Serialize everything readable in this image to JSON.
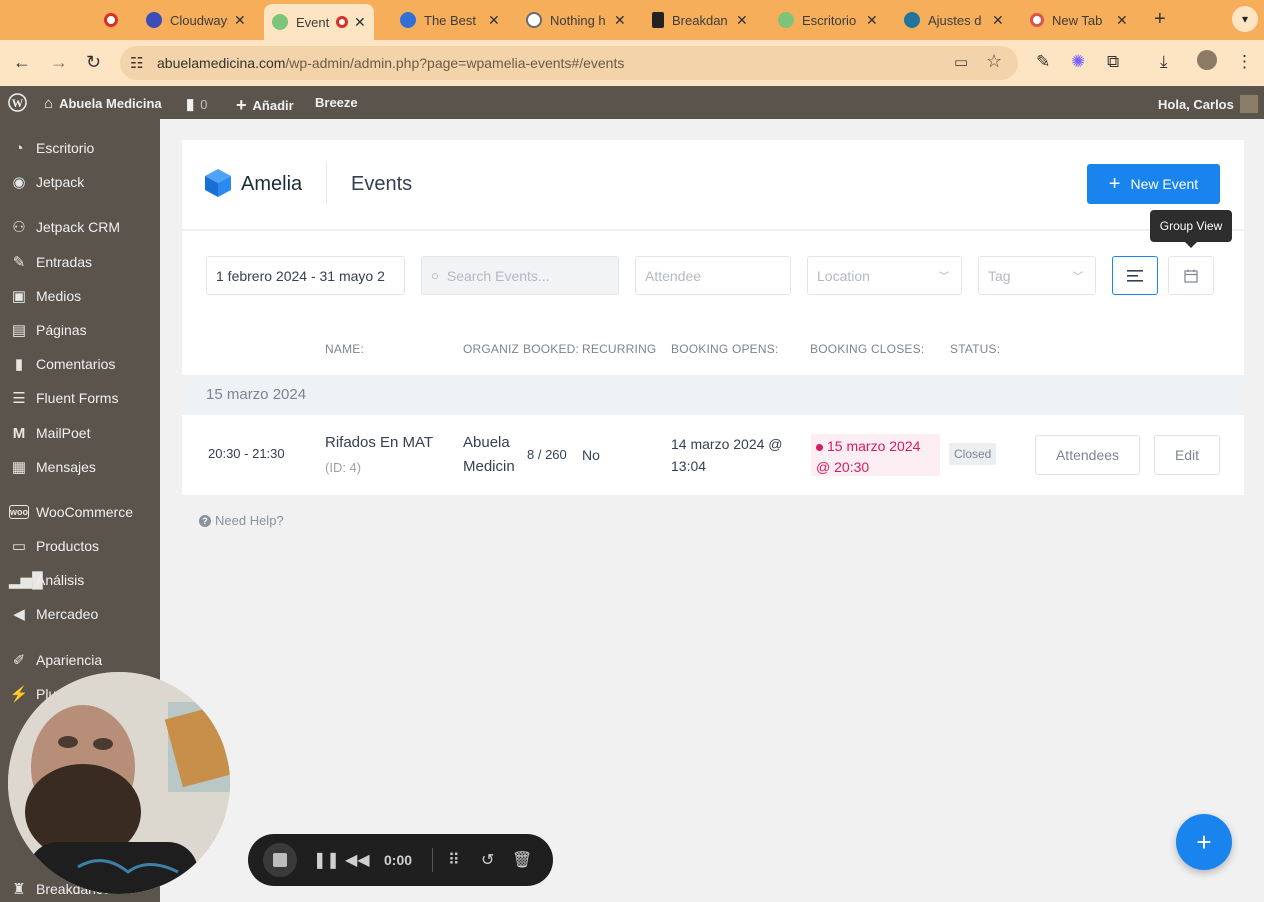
{
  "browser": {
    "tabs": [
      {
        "label": "",
        "favicon_color": "#d93025"
      },
      {
        "label": "Cloudways",
        "favicon_color": "#3b4db8"
      },
      {
        "label": "Events",
        "favicon_color": "#7cc47a",
        "active": true
      },
      {
        "label": "The Best",
        "favicon_color": "#2f6fd6"
      },
      {
        "label": "Nothing h",
        "favicon_color": "#6b6b6b"
      },
      {
        "label": "Breakdan",
        "favicon_color": "#222222"
      },
      {
        "label": "Escritorio",
        "favicon_color": "#7cc47a"
      },
      {
        "label": "Ajustes d",
        "favicon_color": "#21759b"
      },
      {
        "label": "New Tab",
        "favicon_color": "#d9534f"
      }
    ],
    "url_host": "abuelamedicina.com",
    "url_path": "/wp-admin/admin.php?page=wpamelia-events#/events"
  },
  "adminbar": {
    "site_name": "Abuela Medicina",
    "comments_count": "0",
    "add_label": "Añadir",
    "breeze_label": "Breeze",
    "greeting": "Hola, Carlos"
  },
  "sidebar": {
    "items": [
      {
        "label": "Escritorio",
        "icon": "dashboard-icon"
      },
      {
        "label": "Jetpack",
        "icon": "jetpack-icon"
      },
      {
        "label": "Jetpack CRM",
        "icon": "crm-icon"
      },
      {
        "label": "Entradas",
        "icon": "pin-icon"
      },
      {
        "label": "Medios",
        "icon": "media-icon"
      },
      {
        "label": "Páginas",
        "icon": "pages-icon"
      },
      {
        "label": "Comentarios",
        "icon": "comments-icon"
      },
      {
        "label": "Fluent Forms",
        "icon": "forms-icon"
      },
      {
        "label": "MailPoet",
        "icon": "mailpoet-icon"
      },
      {
        "label": "Mensajes",
        "icon": "messages-icon"
      },
      {
        "label": "WooCommerce",
        "icon": "woo-icon"
      },
      {
        "label": "Productos",
        "icon": "products-icon"
      },
      {
        "label": "Análisis",
        "icon": "analytics-icon"
      },
      {
        "label": "Mercadeo",
        "icon": "megaphone-icon"
      },
      {
        "label": "Apariencia",
        "icon": "brush-icon"
      },
      {
        "label": "Plu",
        "icon": "plugins-icon"
      },
      {
        "label": "Breakdance",
        "icon": "breakdance-icon"
      }
    ]
  },
  "header": {
    "logo_text": "Amelia",
    "page_title": "Events",
    "new_event_label": "New Event"
  },
  "filters": {
    "date_range": "1 febrero 2024 - 31 mayo 2",
    "search_placeholder": "Search Events...",
    "attendee_placeholder": "Attendee",
    "location_placeholder": "Location",
    "tag_placeholder": "Tag",
    "tooltip": "Group View"
  },
  "table": {
    "columns": [
      "NAME:",
      "ORGANIZ",
      "BOOKED:",
      "RECURRING",
      "BOOKING OPENS:",
      "BOOKING CLOSES:",
      "STATUS:"
    ],
    "group_date": "15 marzo 2024",
    "rows": [
      {
        "time": "20:30 - 21:30",
        "name": "Rifados En MAT",
        "id": "(ID: 4)",
        "organizer_line1": "Abuela",
        "organizer_line2": "Medicin",
        "booked": "8 / 260",
        "recurring": "No",
        "opens_line1": "14 marzo 2024 @",
        "opens_line2": "13:04",
        "closes_line1": "15 marzo 2024",
        "closes_line2": "@ 20:30",
        "status": "Closed",
        "attendees_label": "Attendees",
        "edit_label": "Edit"
      }
    ]
  },
  "help_label": "Need Help?",
  "recorder": {
    "time": "0:00"
  },
  "colors": {
    "accent": "#1a84ee",
    "closed_date": "#d81b60",
    "sidebar": "#5a544d",
    "tabstrip": "#f6ae5a"
  }
}
